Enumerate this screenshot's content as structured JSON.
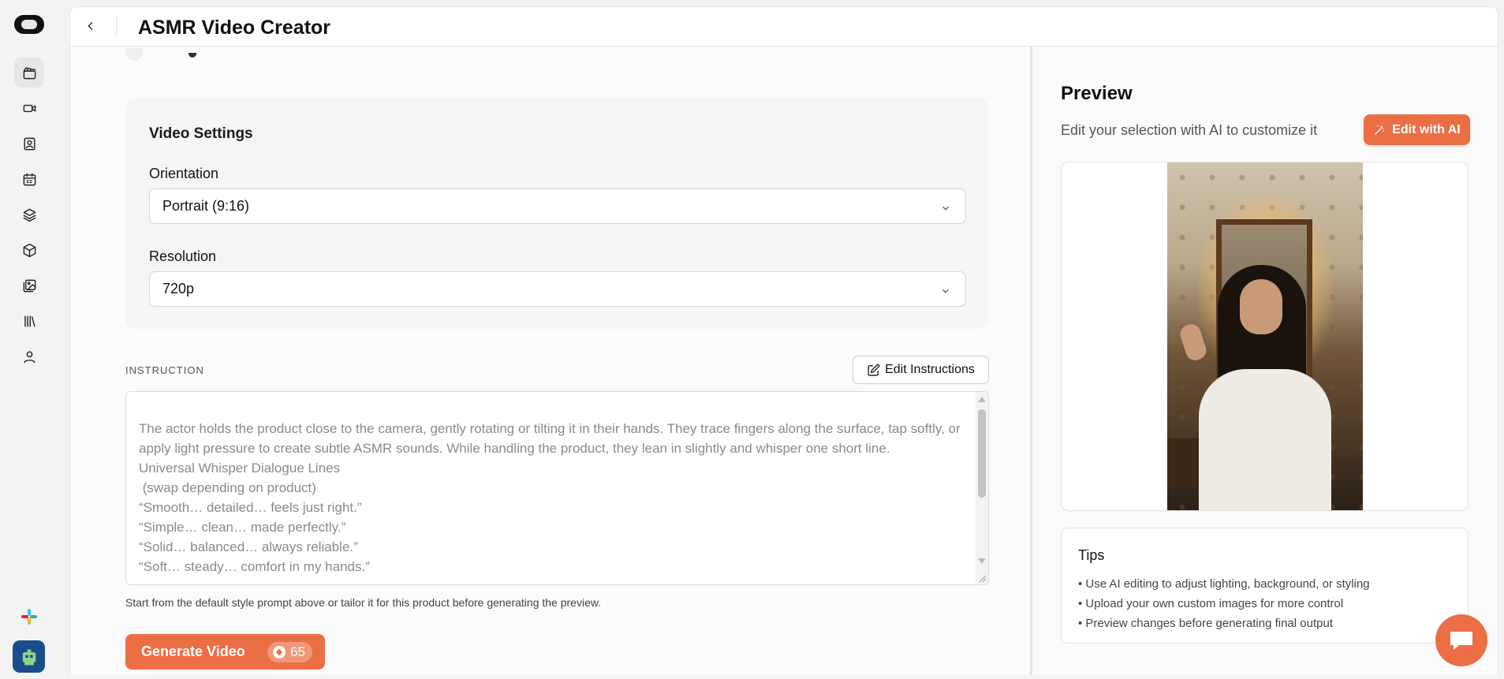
{
  "header": {
    "title": "ASMR Video Creator"
  },
  "settings": {
    "card_title": "Video Settings",
    "orientation_label": "Orientation",
    "orientation_value": "Portrait (9:16)",
    "resolution_label": "Resolution",
    "resolution_value": "720p"
  },
  "instruction": {
    "label": "INSTRUCTION",
    "edit_button": "Edit Instructions",
    "text": "The actor holds the product close to the camera, gently rotating or tilting it in their hands. They trace fingers along the surface, tap softly, or apply light pressure to create subtle ASMR sounds. While handling the product, they lean in slightly and whisper one short line.\nUniversal Whisper Dialogue Lines\n (swap depending on product)\n“Smooth… detailed… feels just right.”\n“Simple… clean… made perfectly.”\n“Solid… balanced… always reliable.”\n“Soft… steady… comfort in my hands.”",
    "hint": "Start from the default style prompt above or tailor it for this product before generating the preview."
  },
  "generate": {
    "label": "Generate Video",
    "credits": "65"
  },
  "preview": {
    "title": "Preview",
    "subtitle": "Edit your selection with AI to customize it",
    "edit_ai_button": "Edit with AI"
  },
  "tips": {
    "title": "Tips",
    "items": [
      "• Use AI editing to adjust lighting, background, or styling",
      "• Upload your own custom images for more control",
      "• Preview changes before generating final output"
    ]
  },
  "colors": {
    "accent": "#ec6e45",
    "background": "#f3f3f3",
    "card": "#f5f5f5"
  },
  "rail_icons": [
    "clapperboard-icon",
    "video-camera-icon",
    "contact-card-icon",
    "calendar-icon",
    "layers-icon",
    "box-icon",
    "image-gallery-icon",
    "library-icon",
    "user-icon"
  ]
}
